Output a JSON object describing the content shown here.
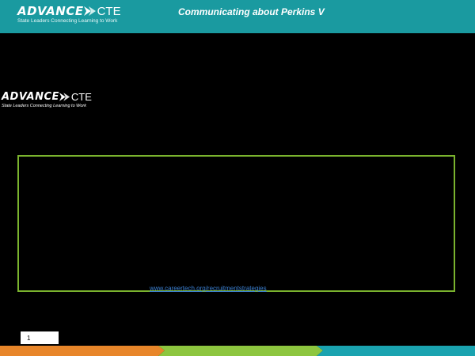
{
  "header": {
    "logo": {
      "word": "ADVANCE",
      "suffix": "CTE",
      "tagline": "State Leaders Connecting Learning to Work"
    },
    "title": "Communicating about Perkins V"
  },
  "body_logo": {
    "word": "ADVANCE",
    "suffix": "CTE",
    "tagline": "State Leaders Connecting Learning to Work"
  },
  "content": {
    "link_text": "www.careertech.org/recruitmentstrategies"
  },
  "footer": {
    "page_number": "1"
  },
  "colors": {
    "header_teal": "#1a9aa0",
    "box_border_green": "#7ab32e",
    "link_blue": "#3a7fd0",
    "footer_orange": "#e8862a",
    "footer_green": "#8dc63f",
    "footer_teal": "#1aa3b0"
  }
}
